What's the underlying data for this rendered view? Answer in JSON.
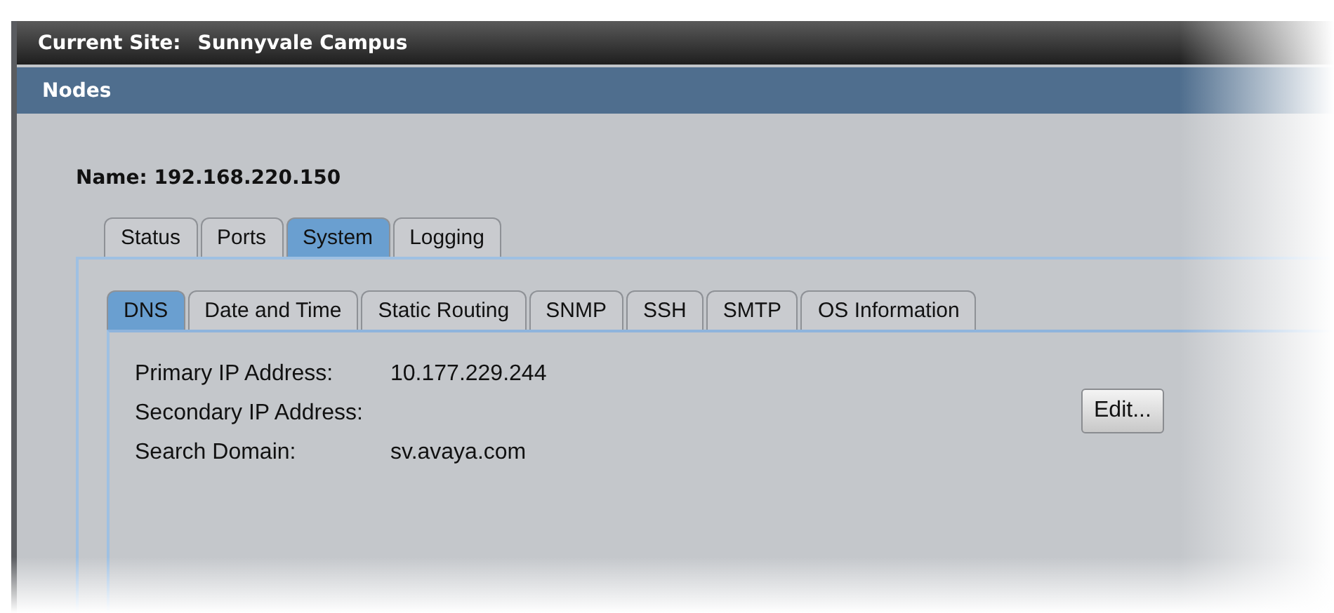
{
  "current_site": {
    "label": "Current Site:",
    "value": "Sunnyvale Campus"
  },
  "section_title": "Nodes",
  "node_name": "Name: 192.168.220.150",
  "tabs": [
    {
      "label": "Status",
      "selected": false
    },
    {
      "label": "Ports",
      "selected": false
    },
    {
      "label": "System",
      "selected": true
    },
    {
      "label": "Logging",
      "selected": false
    }
  ],
  "sub_tabs": [
    {
      "label": "DNS",
      "selected": true
    },
    {
      "label": "Date and Time",
      "selected": false
    },
    {
      "label": "Static Routing",
      "selected": false
    },
    {
      "label": "SNMP",
      "selected": false
    },
    {
      "label": "SSH",
      "selected": false
    },
    {
      "label": "SMTP",
      "selected": false
    },
    {
      "label": "OS Information",
      "selected": false
    }
  ],
  "fields": [
    {
      "label": "Primary IP Address:",
      "value": "10.177.229.244"
    },
    {
      "label": "Secondary IP Address:"
    },
    {
      "label": "Search Domain:",
      "value": "sv.avaya.com"
    }
  ],
  "edit_button": "Edit..."
}
